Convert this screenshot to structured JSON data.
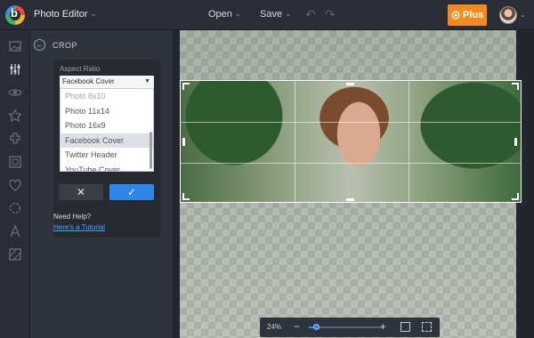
{
  "header": {
    "app_title": "Photo Editor",
    "open_label": "Open",
    "save_label": "Save",
    "plus_label": "Plus",
    "accent_color": "#f48a1e"
  },
  "rail": {
    "icons": [
      "image-icon",
      "sliders-icon",
      "eye-icon",
      "star-icon",
      "puzzle-icon",
      "frame-icon",
      "heart-icon",
      "shape-icon",
      "text-icon",
      "texture-icon"
    ],
    "active_icon": "sliders-icon"
  },
  "panel": {
    "title": "CROP",
    "aspect_label": "Aspect Ratio",
    "selected_value": "Facebook Cover",
    "options": [
      {
        "label": "Photo 8x10",
        "selected": false
      },
      {
        "label": "Photo 11x14",
        "selected": false
      },
      {
        "label": "Photo 16x9",
        "selected": false
      },
      {
        "label": "Facebook Cover",
        "selected": true
      },
      {
        "label": "Twitter Header",
        "selected": false
      },
      {
        "label": "YouTube Cover",
        "selected": false
      }
    ],
    "help_title": "Need Help?",
    "help_link": "Here's a Tutorial",
    "apply_color": "#2e86e8"
  },
  "zoom": {
    "percent_label": "24%",
    "level_fraction": 0.1
  }
}
